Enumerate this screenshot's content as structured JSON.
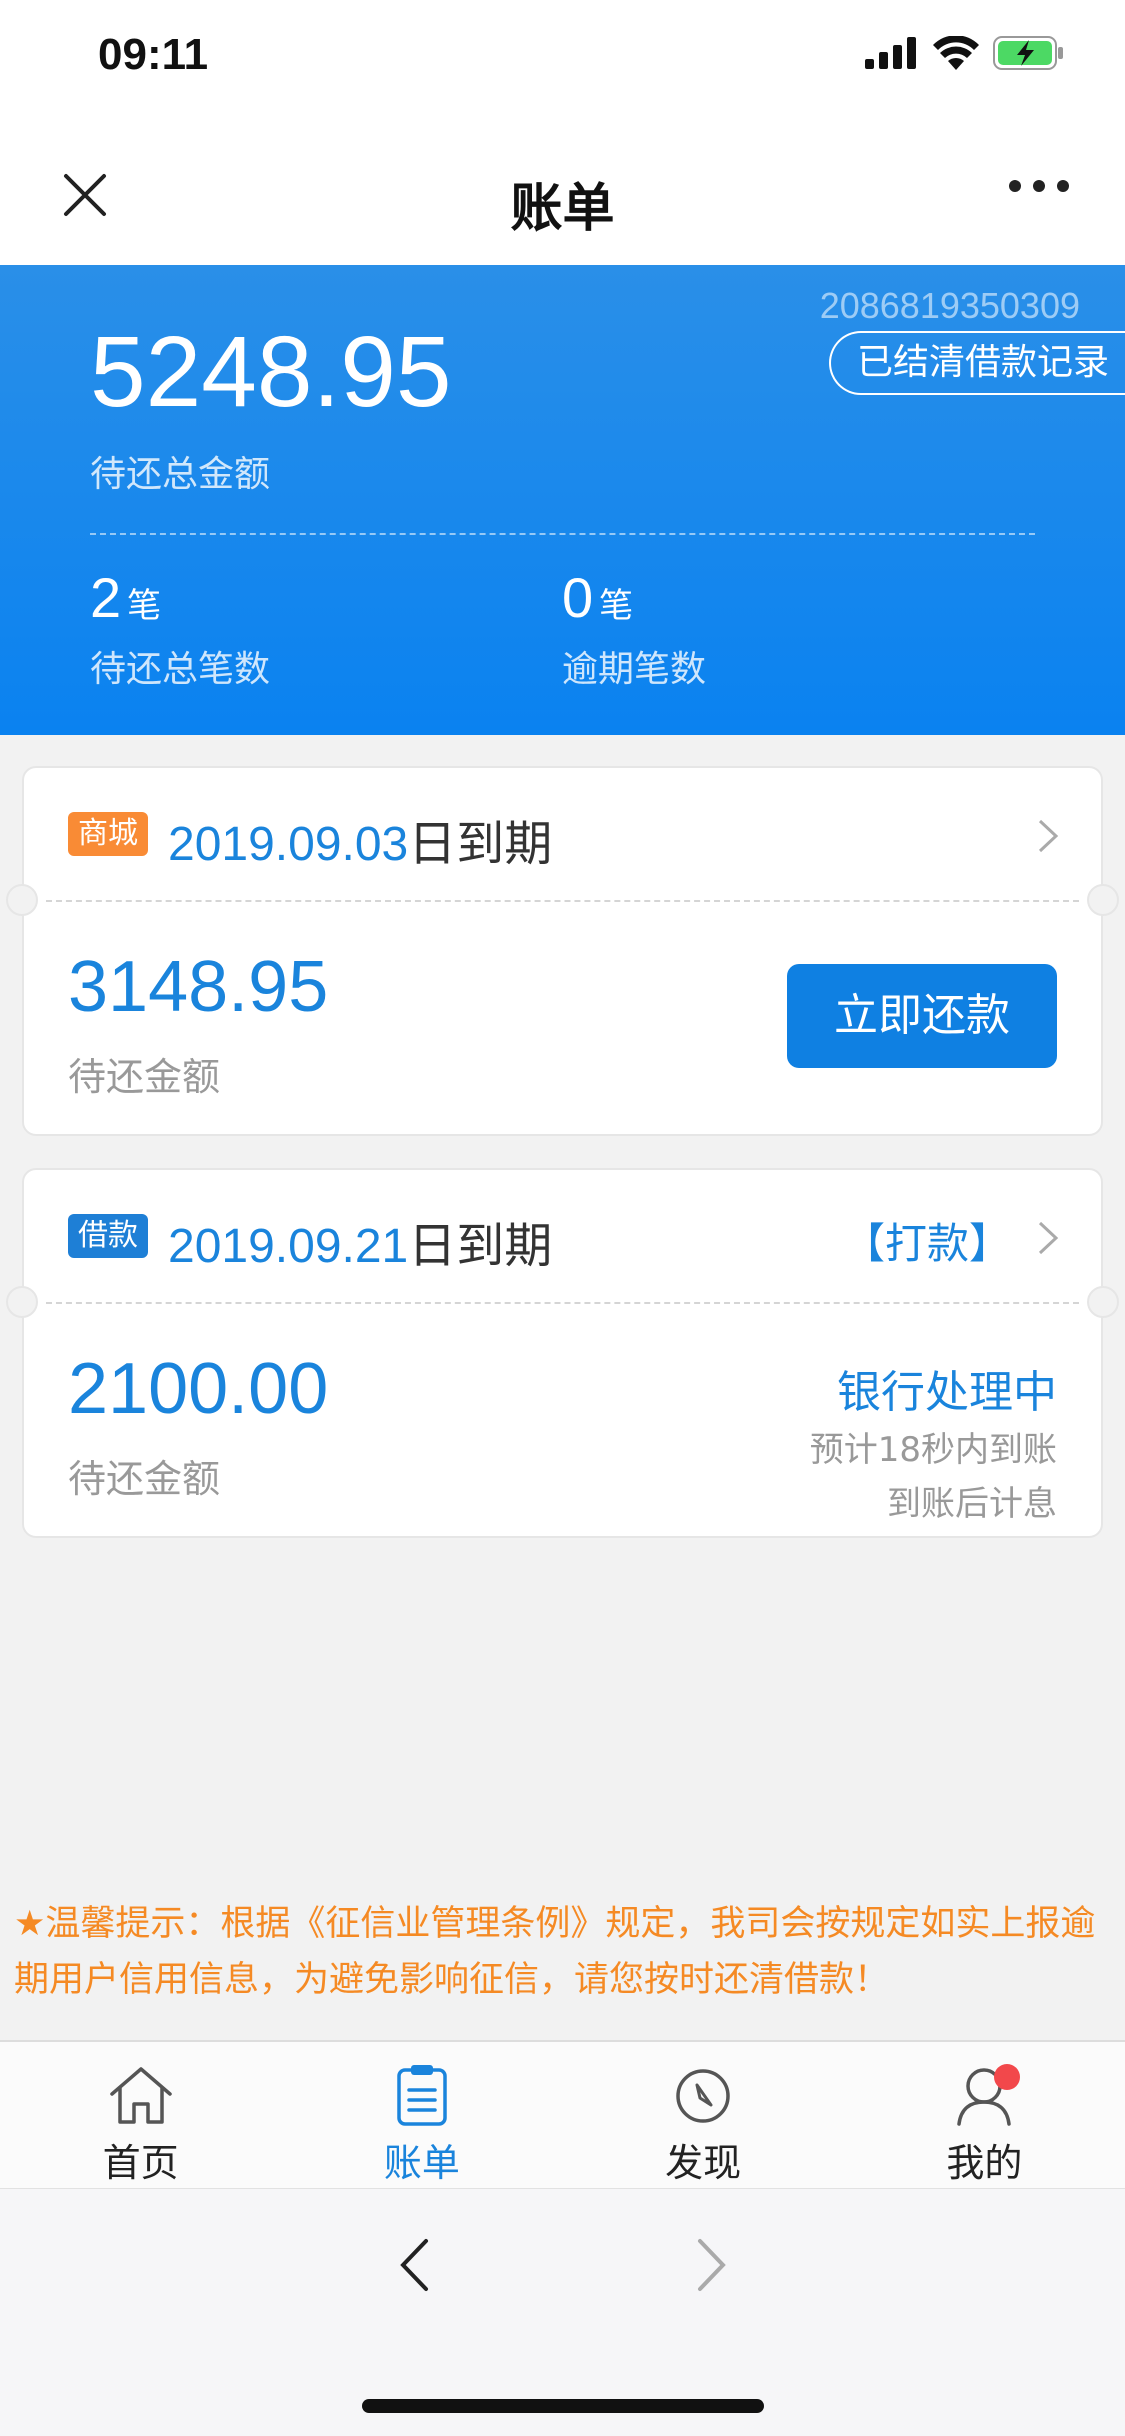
{
  "status_bar": {
    "time": "09:11"
  },
  "nav": {
    "title": "账单"
  },
  "summary": {
    "account_no": "2086819350309",
    "settled_button": "已结清借款记录",
    "total_amount": "5248.95",
    "total_label": "待还总金额",
    "pending_count": "2",
    "pending_unit": "笔",
    "pending_label": "待还总笔数",
    "overdue_count": "0",
    "overdue_unit": "笔",
    "overdue_label": "逾期笔数"
  },
  "bills": [
    {
      "tag": "商城",
      "due_date": "2019.09.03",
      "due_suffix": "日到期",
      "amount": "3148.95",
      "amount_label": "待还金额",
      "action": "立即还款"
    },
    {
      "tag": "借款",
      "due_date": "2019.09.21",
      "due_suffix": "日到期",
      "transfer_label": "【打款】",
      "amount": "2100.00",
      "amount_label": "待还金额",
      "status": "银行处理中",
      "eta": "预计18秒内到账",
      "interest_note": "到账后计息"
    }
  ],
  "tip": "★温馨提示：根据《征信业管理条例》规定，我司会按规定如实上报逾期用户信用信息，为避免影响征信，请您按时还清借款！",
  "tabs": [
    {
      "label": "首页",
      "icon": "home-icon"
    },
    {
      "label": "账单",
      "icon": "bill-icon",
      "active": true
    },
    {
      "label": "发现",
      "icon": "compass-icon"
    },
    {
      "label": "我的",
      "icon": "user-icon",
      "badge": true
    }
  ],
  "colors": {
    "primary": "#0f80e2",
    "accent_orange": "#f98b35",
    "tip": "#f58a24",
    "badge": "#f2484b"
  }
}
